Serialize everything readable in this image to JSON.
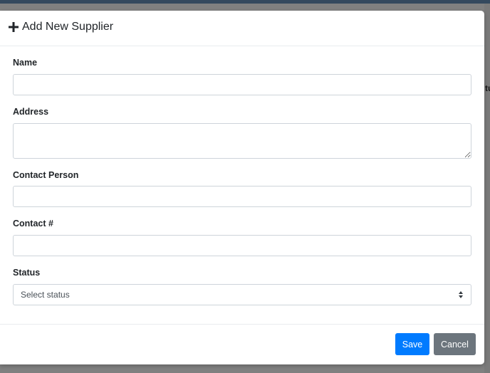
{
  "background": {
    "peek_text": "tu"
  },
  "modal": {
    "title": "Add New Supplier",
    "title_icon": "plus-icon"
  },
  "form": {
    "name": {
      "label": "Name",
      "value": ""
    },
    "address": {
      "label": "Address",
      "value": ""
    },
    "contact_person": {
      "label": "Contact Person",
      "value": ""
    },
    "contact_number": {
      "label": "Contact #",
      "value": ""
    },
    "status": {
      "label": "Status",
      "selected": "Select status"
    }
  },
  "footer": {
    "save_label": "Save",
    "cancel_label": "Cancel"
  },
  "colors": {
    "primary": "#007bff",
    "secondary": "#6c757d",
    "backdrop": "#808080"
  }
}
